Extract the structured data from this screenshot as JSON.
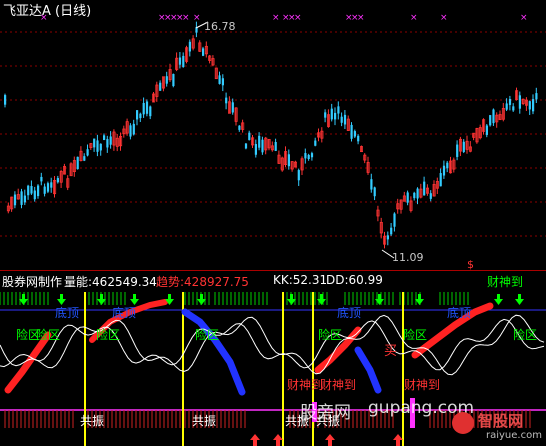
{
  "title": "飞亚达A (日线)",
  "price_high_label": "16.78",
  "price_low_label": "11.09",
  "dollar_sign": "$",
  "indicator": {
    "name": "股券网制作",
    "volume_label": "量能:462549.34",
    "trend_label": "趋势:428927.75",
    "kk_label": "KK:52.31",
    "dd_label": "DD:60.99",
    "caishen_label": "财神到",
    "colors": {
      "volume": "#ffffff",
      "trend": "#ff3333",
      "kk": "#ffffff",
      "dd": "#ffffff",
      "caishen": "#00ff00"
    }
  },
  "zone_labels": {
    "bottom_top": [
      "底顶",
      "底顶",
      "底顶",
      "底顶"
    ],
    "risk_zone": [
      "险区",
      "险区",
      "险区",
      "险区",
      "险区",
      "险区",
      "险区"
    ],
    "resonance": [
      "共振",
      "共振",
      "共振",
      "共振"
    ],
    "caishen": [
      "财神到",
      "财神到",
      "财神到"
    ],
    "buy": "买"
  },
  "watermark": {
    "site_cn": "股旁网",
    "site_url": "gupang.com",
    "logo_cn": "智股网",
    "logo_url": "raiyue.com"
  }
}
